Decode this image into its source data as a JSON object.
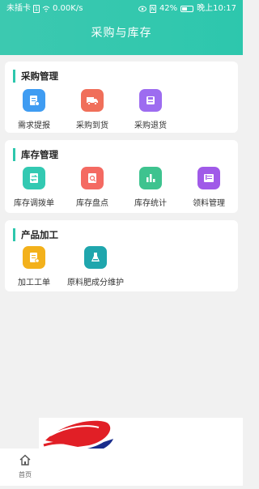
{
  "status": {
    "carrier": "未插卡",
    "sim_icon": "sim-icon",
    "speed": "0.00K/s",
    "nfc": "N",
    "battery": "42%",
    "time": "晚上10:17"
  },
  "header": {
    "title": "采购与库存"
  },
  "sections": [
    {
      "title": "采购管理",
      "items": [
        {
          "label": "需求提报",
          "color": "#3f9cf2",
          "icon": "document-icon"
        },
        {
          "label": "采购到货",
          "color": "#f06f5a",
          "icon": "truck-icon"
        },
        {
          "label": "采购退货",
          "color": "#9d6cf0",
          "icon": "return-box-icon"
        }
      ]
    },
    {
      "title": "库存管理",
      "items": [
        {
          "label": "库存调拨单",
          "color": "#33c9b2",
          "icon": "transfer-icon"
        },
        {
          "label": "库存盘点",
          "color": "#f46a62",
          "icon": "inventory-icon"
        },
        {
          "label": "库存统计",
          "color": "#3ec38f",
          "icon": "bar-chart-icon"
        },
        {
          "label": "领料管理",
          "color": "#a05ae8",
          "icon": "material-icon"
        }
      ]
    },
    {
      "title": "产品加工",
      "items": [
        {
          "label": "加工工单",
          "color": "#f3b11b",
          "icon": "work-order-icon"
        },
        {
          "label": "原料肥成分维护",
          "color": "#1fa6ad",
          "icon": "flask-icon"
        }
      ]
    }
  ],
  "nav": {
    "home_label": "首页"
  }
}
